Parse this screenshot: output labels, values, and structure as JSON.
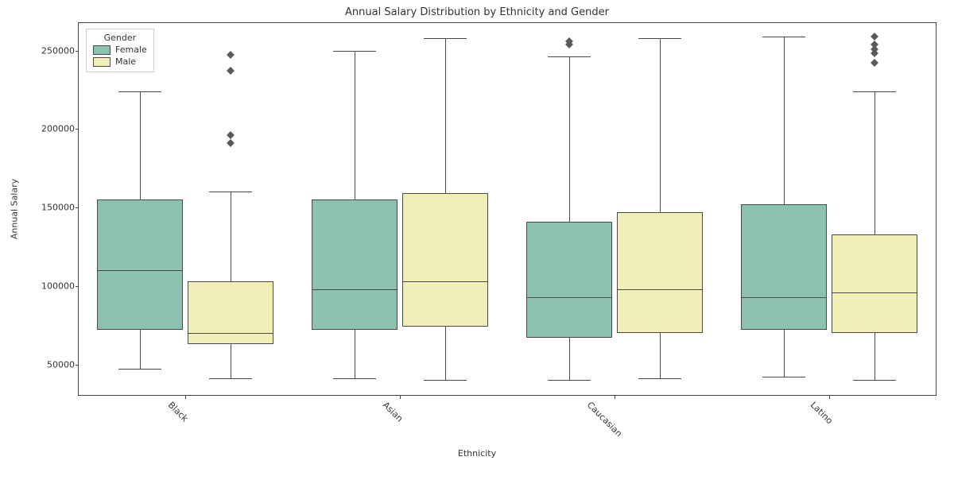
{
  "chart_data": {
    "type": "box",
    "title": "Annual Salary Distribution by Ethnicity and Gender",
    "xlabel": "Ethnicity",
    "ylabel": "Annual Salary",
    "ylim": [
      30000,
      268000
    ],
    "y_ticks": [
      50000,
      100000,
      150000,
      200000,
      250000
    ],
    "y_tick_labels": [
      "50000",
      "100000",
      "150000",
      "200000",
      "250000"
    ],
    "categories": [
      "Black",
      "Asian",
      "Caucasian",
      "Latino"
    ],
    "hue": "Gender",
    "legend": {
      "title": "Gender",
      "items": [
        "Female",
        "Male"
      ]
    },
    "colors": {
      "Female": "#8cc1b2",
      "Male": "#f1eeb8"
    },
    "series": [
      {
        "name": "Female",
        "values": [
          {
            "ethnicity": "Black",
            "whisker_low": 47000,
            "q1": 72000,
            "median": 110000,
            "q3": 155000,
            "whisker_high": 224000,
            "outliers": []
          },
          {
            "ethnicity": "Asian",
            "whisker_low": 41000,
            "q1": 72000,
            "median": 98000,
            "q3": 155000,
            "whisker_high": 250000,
            "outliers": []
          },
          {
            "ethnicity": "Caucasian",
            "whisker_low": 40000,
            "q1": 67000,
            "median": 93000,
            "q3": 141000,
            "whisker_high": 246000,
            "outliers": [
              254000,
              256000
            ]
          },
          {
            "ethnicity": "Latino",
            "whisker_low": 42000,
            "q1": 72000,
            "median": 93000,
            "q3": 152000,
            "whisker_high": 259000,
            "outliers": []
          }
        ]
      },
      {
        "name": "Male",
        "values": [
          {
            "ethnicity": "Black",
            "whisker_low": 41000,
            "q1": 63000,
            "median": 70000,
            "q3": 103000,
            "whisker_high": 160000,
            "outliers": [
              191000,
              196000,
              237000,
              247000
            ]
          },
          {
            "ethnicity": "Asian",
            "whisker_low": 40000,
            "q1": 74000,
            "median": 103000,
            "q3": 159000,
            "whisker_high": 258000,
            "outliers": []
          },
          {
            "ethnicity": "Caucasian",
            "whisker_low": 41000,
            "q1": 70000,
            "median": 98000,
            "q3": 147000,
            "whisker_high": 258000,
            "outliers": []
          },
          {
            "ethnicity": "Latino",
            "whisker_low": 40000,
            "q1": 70000,
            "median": 96000,
            "q3": 133000,
            "whisker_high": 224000,
            "outliers": [
              242000,
              248000,
              251000,
              254000,
              259000
            ]
          }
        ]
      }
    ]
  }
}
